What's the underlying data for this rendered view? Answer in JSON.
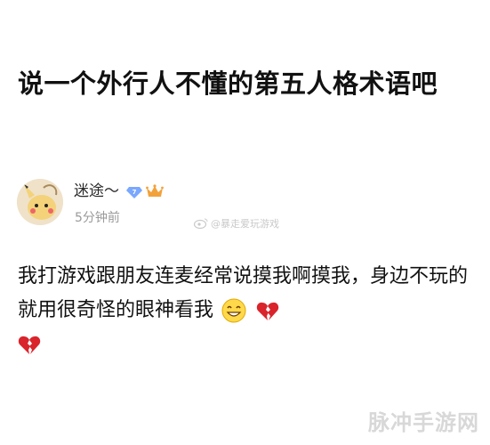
{
  "post": {
    "title": "说一个外行人不懂的第五人格术语吧",
    "body_text": "我打游戏跟朋友连麦经常说摸我啊摸我，身边不玩的就用很奇怪的眼神看我"
  },
  "author": {
    "name": "迷途～",
    "level_badge": "7",
    "time": "5分钟前"
  },
  "watermark": {
    "text": "@暴走爱玩游戏"
  },
  "site_watermark": "脉冲手游网",
  "icons": {
    "avatar": "pikachu-avatar",
    "level": "diamond-level-icon",
    "crown": "crown-icon",
    "smile": "grinning-emoji",
    "broken_heart": "broken-heart-emoji"
  },
  "colors": {
    "level_badge": "#7aa7ff",
    "crown": "#f2a23a",
    "heart": "#d9242c"
  }
}
